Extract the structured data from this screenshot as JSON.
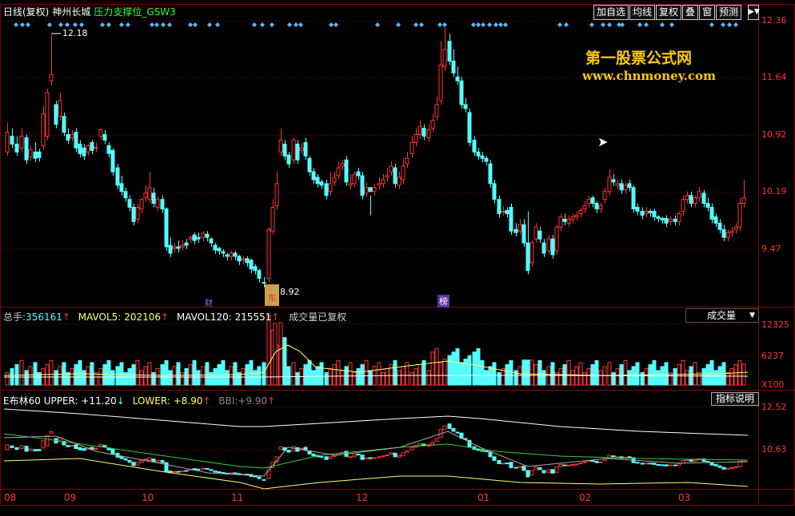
{
  "header": {
    "period": "日线(复权)",
    "stock": "神州长城",
    "indicator": "压力支撑位_GSW3"
  },
  "buttons": [
    "加自选",
    "均线",
    "复权",
    "叠",
    "窗",
    "预测"
  ],
  "price_axis": [
    "12.36",
    "11.64",
    "10.92",
    "10.19",
    "9.47"
  ],
  "markers": {
    "high": "12.18",
    "low": "8.92",
    "tags": [
      "财",
      "东",
      "榜"
    ]
  },
  "volume": {
    "total_label": "总手:",
    "total": "356161",
    "mavol5_label": "MAVOL5:",
    "mavol5": "202106",
    "mavol120_label": "MAVOL120:",
    "mavol120": "215551",
    "note": "成交量已复权",
    "selector": "成交量",
    "axis": [
      "12325",
      "6237",
      "X100"
    ]
  },
  "boll": {
    "name": "E布林60",
    "upper_label": "UPPER:",
    "upper": "+11.20",
    "lower_label": "LOWER:",
    "lower": "+8.90",
    "bbi_label": "BBI:",
    "bbi": "+9.90",
    "help": "指标说明",
    "axis": [
      "12.52",
      "10.63"
    ]
  },
  "dates": [
    "08",
    "09",
    "10",
    "11",
    "12",
    "01",
    "02",
    "03"
  ],
  "watermark": {
    "line1": "第一股票公式网",
    "line2": "www.chnmoney.com"
  },
  "colors": {
    "up": "#ff3333",
    "down": "#54fcfc",
    "grid": "#800000",
    "accent": "#ffcc00"
  }
}
